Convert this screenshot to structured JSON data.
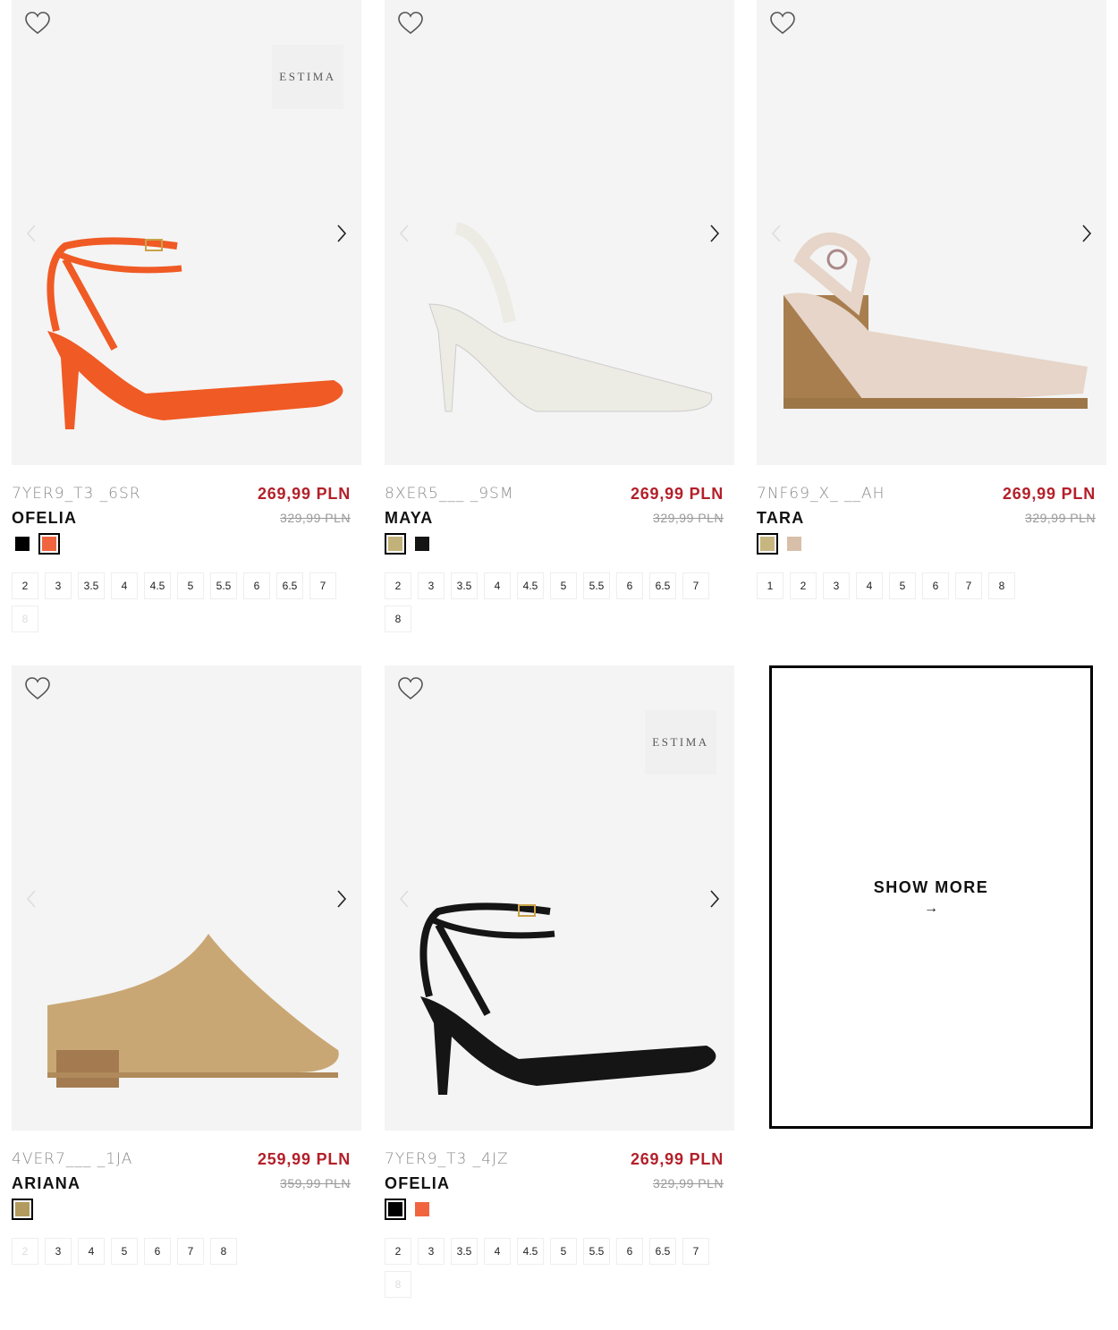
{
  "brand_badge": "ESTIMA",
  "show_more": {
    "label": "SHOW MORE",
    "arrow": "→"
  },
  "products": [
    {
      "sku": "7YER9_T3 _6SR",
      "name": "OFELIA",
      "price": "269,99 PLN",
      "old_price": "329,99 PLN",
      "brand_badge": true,
      "shoe_color": "#f05a24",
      "swatches": [
        {
          "color": "#000000",
          "selected": false
        },
        {
          "color": "#f06540",
          "selected": true
        }
      ],
      "sizes": [
        {
          "label": "2",
          "available": true
        },
        {
          "label": "3",
          "available": true
        },
        {
          "label": "3.5",
          "available": true
        },
        {
          "label": "4",
          "available": true
        },
        {
          "label": "4.5",
          "available": true
        },
        {
          "label": "5",
          "available": true
        },
        {
          "label": "5.5",
          "available": true
        },
        {
          "label": "6",
          "available": true
        },
        {
          "label": "6.5",
          "available": true
        },
        {
          "label": "7",
          "available": true
        },
        {
          "label": "8",
          "available": false
        }
      ]
    },
    {
      "sku": "8XER5___ _9SM",
      "name": "MAYA",
      "price": "269,99 PLN",
      "old_price": "329,99 PLN",
      "brand_badge": false,
      "shoe_color": "#ecebe4",
      "swatches": [
        {
          "color": "#c2b178",
          "selected": true
        },
        {
          "color": "#141414",
          "selected": false
        }
      ],
      "sizes": [
        {
          "label": "2",
          "available": true
        },
        {
          "label": "3",
          "available": true
        },
        {
          "label": "3.5",
          "available": true
        },
        {
          "label": "4",
          "available": true
        },
        {
          "label": "4.5",
          "available": true
        },
        {
          "label": "5",
          "available": true
        },
        {
          "label": "5.5",
          "available": true
        },
        {
          "label": "6",
          "available": true
        },
        {
          "label": "6.5",
          "available": true
        },
        {
          "label": "7",
          "available": true
        },
        {
          "label": "8",
          "available": true
        }
      ]
    },
    {
      "sku": "7NF69_X_ __AH",
      "name": "TARA",
      "price": "269,99 PLN",
      "old_price": "329,99 PLN",
      "brand_badge": false,
      "shoe_color": "#e6d5c8",
      "swatches": [
        {
          "color": "#c8b680",
          "selected": true
        },
        {
          "color": "#d8bfaa",
          "selected": false
        }
      ],
      "sizes": [
        {
          "label": "1",
          "available": true
        },
        {
          "label": "2",
          "available": true
        },
        {
          "label": "3",
          "available": true
        },
        {
          "label": "4",
          "available": true
        },
        {
          "label": "5",
          "available": true
        },
        {
          "label": "6",
          "available": true
        },
        {
          "label": "7",
          "available": true
        },
        {
          "label": "8",
          "available": true
        }
      ]
    },
    {
      "sku": "4VER7___ _1JA",
      "name": "ARIANA",
      "price": "259,99 PLN",
      "old_price": "359,99 PLN",
      "brand_badge": false,
      "shoe_color": "#c9a774",
      "swatches": [
        {
          "color": "#b39a5e",
          "selected": true
        }
      ],
      "sizes": [
        {
          "label": "2",
          "available": false
        },
        {
          "label": "3",
          "available": true
        },
        {
          "label": "4",
          "available": true
        },
        {
          "label": "5",
          "available": true
        },
        {
          "label": "6",
          "available": true
        },
        {
          "label": "7",
          "available": true
        },
        {
          "label": "8",
          "available": true
        }
      ]
    },
    {
      "sku": "7YER9_T3 _4JZ",
      "name": "OFELIA",
      "price": "269,99 PLN",
      "old_price": "329,99 PLN",
      "brand_badge": true,
      "shoe_color": "#151515",
      "swatches": [
        {
          "color": "#000000",
          "selected": true
        },
        {
          "color": "#f06540",
          "selected": false
        }
      ],
      "sizes": [
        {
          "label": "2",
          "available": true
        },
        {
          "label": "3",
          "available": true
        },
        {
          "label": "3.5",
          "available": true
        },
        {
          "label": "4",
          "available": true
        },
        {
          "label": "4.5",
          "available": true
        },
        {
          "label": "5",
          "available": true
        },
        {
          "label": "5.5",
          "available": true
        },
        {
          "label": "6",
          "available": true
        },
        {
          "label": "6.5",
          "available": true
        },
        {
          "label": "7",
          "available": true
        },
        {
          "label": "8",
          "available": false
        }
      ]
    }
  ]
}
